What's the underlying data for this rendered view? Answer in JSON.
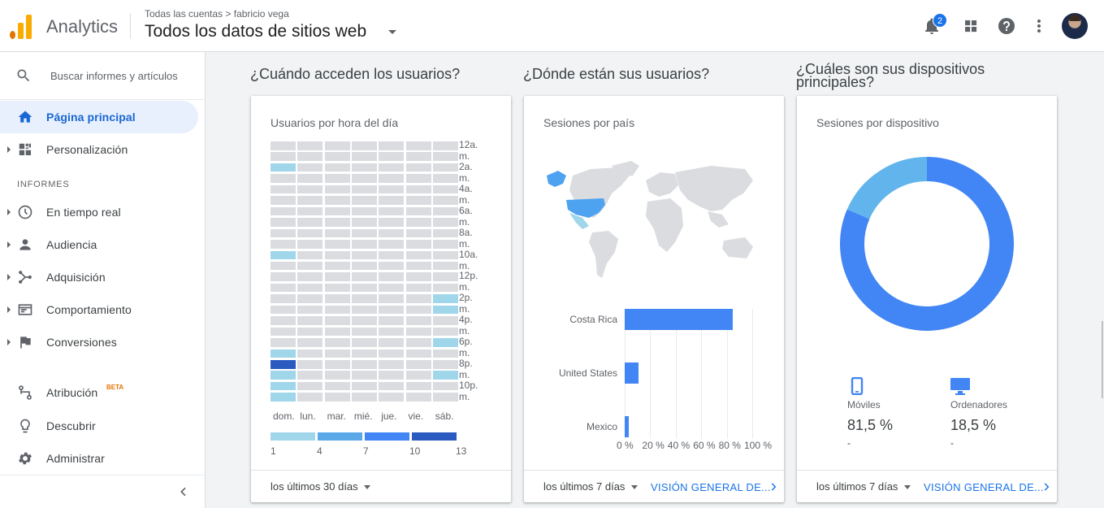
{
  "app": {
    "name": "Analytics",
    "breadcrumb": "Todas las cuentas > fabricio vega",
    "view": "Todos los datos de sitios web",
    "notifications": "2"
  },
  "sidebar": {
    "search_label": "Buscar informes y artículos",
    "items": [
      {
        "label": "Página principal",
        "icon": "home-icon",
        "active": true
      },
      {
        "label": "Personalización",
        "icon": "dashboard-icon"
      }
    ],
    "section": "INFORMES",
    "reports": [
      {
        "label": "En tiempo real",
        "icon": "clock-icon"
      },
      {
        "label": "Audiencia",
        "icon": "person-icon"
      },
      {
        "label": "Adquisición",
        "icon": "acquisition-icon"
      },
      {
        "label": "Comportamiento",
        "icon": "behavior-icon"
      },
      {
        "label": "Conversiones",
        "icon": "flag-icon"
      }
    ],
    "bottom": [
      {
        "label": "Atribución",
        "icon": "attribution-icon",
        "badge": "BETA"
      },
      {
        "label": "Descubrir",
        "icon": "lightbulb-icon"
      },
      {
        "label": "Administrar",
        "icon": "gear-icon"
      }
    ]
  },
  "sections": {
    "when": "¿Cuándo acceden los usuarios?",
    "where": "¿Dónde están sus usuarios?",
    "devices": "¿Cuáles son sus dispositivos principales?"
  },
  "cards": {
    "heatmap": {
      "title": "Usuarios por hora del día",
      "range": "los últimos 30 días",
      "hour_labels": [
        "12a. m.",
        "2a. m.",
        "4a. m.",
        "6a. m.",
        "8a. m.",
        "10a. m.",
        "12p. m.",
        "2p. m.",
        "4p. m.",
        "6p. m.",
        "8p. m.",
        "10p. m."
      ],
      "days": [
        "dom.",
        "lun.",
        "mar.",
        "mié.",
        "jue.",
        "vie.",
        "sáb."
      ],
      "legend": [
        "1",
        "4",
        "7",
        "10",
        "13"
      ],
      "colors": [
        "#dadce0",
        "#9fd6ea",
        "#5aa8e8",
        "#4285f4",
        "#2b5bc0"
      ],
      "highlights": [
        {
          "day": 0,
          "hour": 2,
          "level": 1
        },
        {
          "day": 0,
          "hour": 10,
          "level": 1
        },
        {
          "day": 0,
          "hour": 19,
          "level": 1
        },
        {
          "day": 0,
          "hour": 20,
          "level": 4
        },
        {
          "day": 0,
          "hour": 21,
          "level": 1
        },
        {
          "day": 0,
          "hour": 22,
          "level": 1
        },
        {
          "day": 0,
          "hour": 23,
          "level": 1
        },
        {
          "day": 6,
          "hour": 14,
          "level": 1
        },
        {
          "day": 6,
          "hour": 15,
          "level": 1
        },
        {
          "day": 6,
          "hour": 18,
          "level": 1
        },
        {
          "day": 6,
          "hour": 21,
          "level": 1
        }
      ]
    },
    "countries": {
      "title": "Sesiones por país",
      "range": "los últimos 7 días",
      "link": "VISIÓN GENERAL DE...",
      "xticks": [
        "0 %",
        "20 %",
        "40 %",
        "60 %",
        "80 %",
        "100 %"
      ]
    },
    "devices": {
      "title": "Sesiones por dispositivo",
      "range": "los últimos 7 días",
      "link": "VISIÓN GENERAL DE...",
      "items": [
        {
          "name": "Móviles",
          "value": "81,5 %",
          "sub": "-",
          "icon": "phone-icon",
          "color": "#4285f4"
        },
        {
          "name": "Ordenadores",
          "value": "18,5 %",
          "sub": "-",
          "icon": "desktop-icon",
          "color": "#62b4ec"
        }
      ]
    }
  },
  "chart_data": [
    {
      "type": "bar",
      "title": "Sesiones por país",
      "categories": [
        "Costa Rica",
        "United States",
        "Mexico"
      ],
      "values": [
        85,
        11,
        3
      ],
      "xlim": [
        0,
        100
      ]
    },
    {
      "type": "pie",
      "title": "Sesiones por dispositivo",
      "categories": [
        "Móviles",
        "Ordenadores"
      ],
      "values": [
        81.5,
        18.5
      ]
    }
  ]
}
